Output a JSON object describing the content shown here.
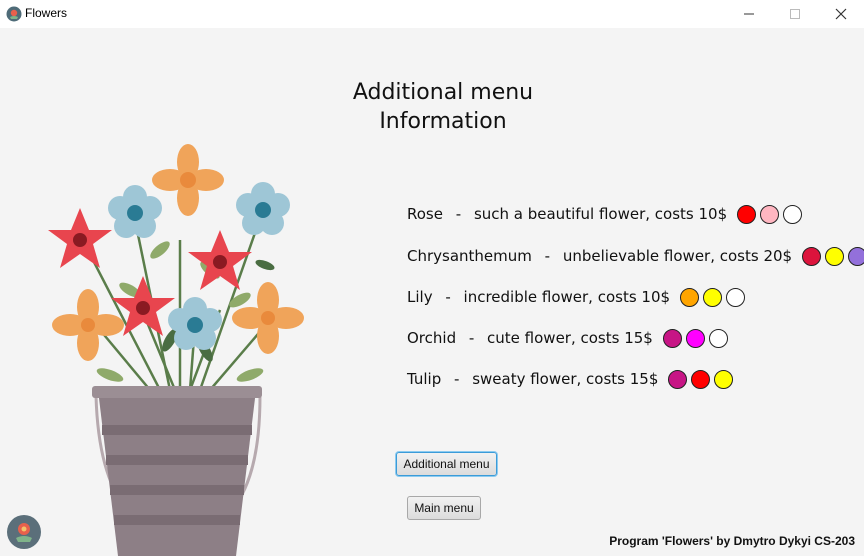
{
  "window": {
    "title": "Flowers",
    "icons": [
      "app-icon",
      "minimize-icon",
      "maximize-icon",
      "close-icon"
    ]
  },
  "heading": {
    "line1": "Additional  menu",
    "line2": "Information"
  },
  "flowers": [
    {
      "name": "Rose",
      "description": "such a beautiful flower, costs 10$",
      "colors": [
        "#ff0000",
        "#ffb6c1",
        "#ffffff"
      ]
    },
    {
      "name": "Chrysanthemum",
      "description": "unbelievable flower, costs 20$",
      "colors": [
        "#dc143c",
        "#ffff00",
        "#9370db"
      ]
    },
    {
      "name": "Lily",
      "description": "incredible flower, costs 10$",
      "colors": [
        "#ffa500",
        "#ffff00",
        "#ffffff"
      ]
    },
    {
      "name": "Orchid",
      "description": "cute flower, costs 15$",
      "colors": [
        "#c71585",
        "#ff00ff",
        "#ffffff"
      ]
    },
    {
      "name": "Tulip",
      "description": "sweaty flower, costs 15$",
      "colors": [
        "#c71585",
        "#ff0000",
        "#ffff00"
      ]
    }
  ],
  "separator": " - ",
  "buttons": {
    "additional_menu": "Additional menu",
    "main_menu": "Main menu"
  },
  "footer": "Program 'Flowers' by Dmytro Dykyi CS-203",
  "illustration": "flower-bucket-illustration"
}
